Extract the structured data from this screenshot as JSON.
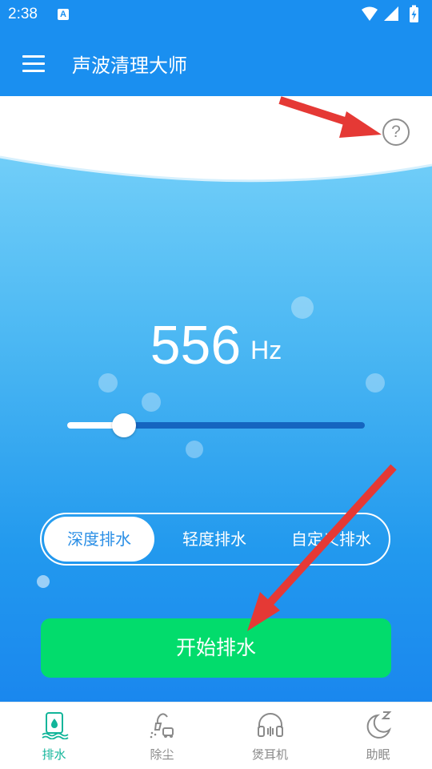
{
  "status_bar": {
    "time": "2:38",
    "notification_letter": "A"
  },
  "app_bar": {
    "title": "声波清理大师"
  },
  "main": {
    "frequency_value": "556",
    "frequency_unit": "Hz",
    "slider_fraction": 0.19,
    "modes": [
      {
        "label": "深度排水",
        "selected": true
      },
      {
        "label": "轻度排水",
        "selected": false
      },
      {
        "label": "自定义排水",
        "selected": false
      }
    ],
    "start_button_label": "开始排水"
  },
  "bottom_nav": {
    "items": [
      {
        "label": "排水",
        "icon": "drain-icon",
        "active": true
      },
      {
        "label": "除尘",
        "icon": "vacuum-icon",
        "active": false
      },
      {
        "label": "煲耳机",
        "icon": "headphones-icon",
        "active": false
      },
      {
        "label": "助眠",
        "icon": "moon-sleep-icon",
        "active": false
      }
    ]
  },
  "colors": {
    "header_blue": "#1a8ff0",
    "start_green": "#02dc6c",
    "active_teal": "#12b59a",
    "annotation_red": "#e53935"
  }
}
